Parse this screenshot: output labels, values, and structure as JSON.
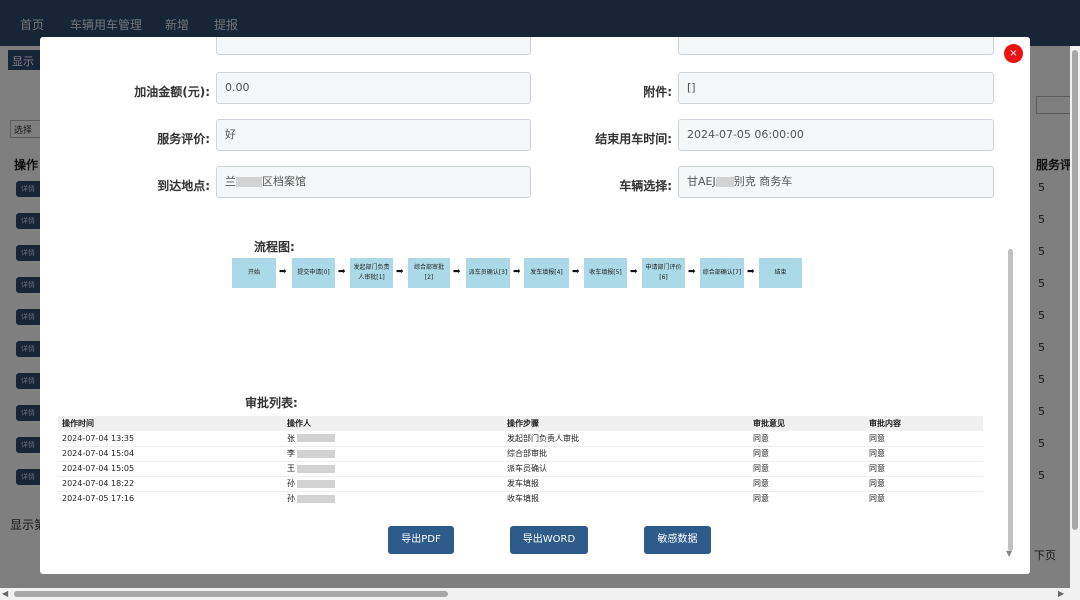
{
  "nav": {
    "items": [
      "首页",
      "车辆用车管理",
      "新增",
      "提报"
    ]
  },
  "background": {
    "show_button": "显示",
    "select_button": "选择",
    "op_column": "操作",
    "row_button": "详情",
    "rows": 10,
    "right_column": "服务评",
    "right_value": "5",
    "footer_text": "显示第",
    "next_page": "下页"
  },
  "form": {
    "fuel_amount": {
      "label": "加油金额(元):",
      "value": "0.00"
    },
    "attachment": {
      "label": "附件:",
      "value": "[]"
    },
    "service_rating": {
      "label": "服务评价:",
      "value": "好"
    },
    "end_time": {
      "label": "结束用车时间:",
      "value": "2024-07-05 06:00:00"
    },
    "destination": {
      "label": "到达地点:",
      "value_prefix": "兰",
      "value_suffix": "区档案馆"
    },
    "vehicle": {
      "label": "车辆选择:",
      "value_prefix": "甘AEJ",
      "value_suffix": "别克 商务车"
    }
  },
  "flow": {
    "title": "流程图:",
    "steps": [
      "开始",
      "提交申请[0]",
      "发起部门负责人审批[1]",
      "综合部审批[2]",
      "派车员确认[3]",
      "发车填报[4]",
      "收车填报[5]",
      "申请部门评价[6]",
      "综合部确认[7]",
      "结束"
    ]
  },
  "approval": {
    "title": "审批列表:",
    "columns": [
      "操作时间",
      "操作人",
      "操作步骤",
      "审批意见",
      "审批内容"
    ],
    "rows": [
      {
        "time": "2024-07-04 13:35",
        "operator": "张",
        "step": "发起部门负责人审批",
        "opinion": "同意",
        "content": "同意"
      },
      {
        "time": "2024-07-04 15:04",
        "operator": "李",
        "step": "综合部审批",
        "opinion": "同意",
        "content": "同意"
      },
      {
        "time": "2024-07-04 15:05",
        "operator": "王",
        "step": "派车员确认",
        "opinion": "同意",
        "content": "同意"
      },
      {
        "time": "2024-07-04 18:22",
        "operator": "孙",
        "step": "发车填报",
        "opinion": "同意",
        "content": "同意"
      },
      {
        "time": "2024-07-05 17:16",
        "operator": "孙",
        "step": "收车填报",
        "opinion": "同意",
        "content": "同意"
      }
    ]
  },
  "buttons": {
    "export_pdf": "导出PDF",
    "export_word": "导出WORD",
    "sensitive": "敏感数据"
  },
  "close_label": "×",
  "colors": {
    "nav_bg": "#2e4a6d",
    "flow_box": "#abd9e8",
    "button_bg": "#2e5b8a",
    "close_red": "#ee1111"
  }
}
